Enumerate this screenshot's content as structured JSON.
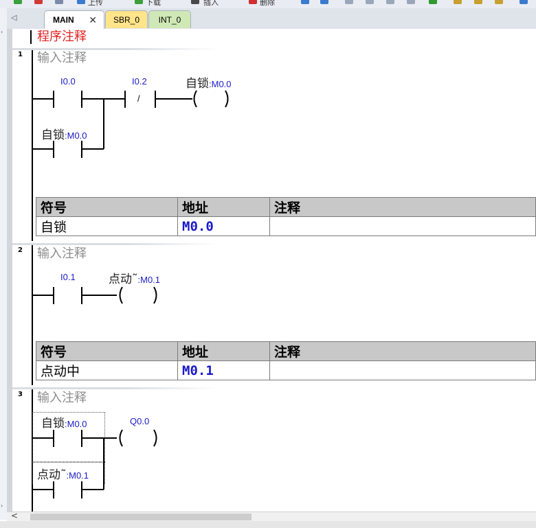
{
  "toolbar": {
    "items": [
      {
        "name": "upload",
        "label": "上传"
      },
      {
        "name": "download",
        "label": "下载"
      },
      {
        "name": "insert",
        "label": "插入"
      },
      {
        "name": "delete",
        "label": "删除"
      }
    ]
  },
  "tabs": [
    {
      "name": "MAIN",
      "label": "MAIN",
      "active": true,
      "color": "#ffffff"
    },
    {
      "name": "SBR_0",
      "label": "SBR_0",
      "active": false,
      "color": "#ffe48a"
    },
    {
      "name": "INT_0",
      "label": "INT_0",
      "active": false,
      "color": "#cfe8b6"
    }
  ],
  "program": {
    "title": "程序注释",
    "networks": [
      {
        "number": "1",
        "comment": "输入注释",
        "labels": {
          "c1": "I0.0",
          "c2": "I0.2",
          "coil_sym": "自锁",
          "coil_addr": ":M0.0",
          "p_sym": "自锁",
          "p_addr": ":M0.0",
          "neg": "/"
        },
        "symbol_table": {
          "headers": [
            "符号",
            "地址",
            "注释"
          ],
          "rows": [
            [
              "自锁",
              "M0.0",
              ""
            ]
          ]
        }
      },
      {
        "number": "2",
        "comment": "输入注释",
        "labels": {
          "c1": "I0.1",
          "coil_sym": "点动˜",
          "coil_addr": ":M0.1"
        },
        "symbol_table": {
          "headers": [
            "符号",
            "地址",
            "注释"
          ],
          "rows": [
            [
              "点动中",
              "M0.1",
              ""
            ]
          ]
        }
      },
      {
        "number": "3",
        "comment": "输入注释",
        "labels": {
          "c1_sym": "自锁",
          "c1_addr": ":M0.0",
          "coil": "Q0.0",
          "p_sym": "点动˜",
          "p_addr": ":M0.1"
        }
      }
    ]
  },
  "colors": {
    "title": "#e02020",
    "comment": "#8c8c8c",
    "address": "#1a1ac8",
    "table_header": "#c8c8c8"
  }
}
